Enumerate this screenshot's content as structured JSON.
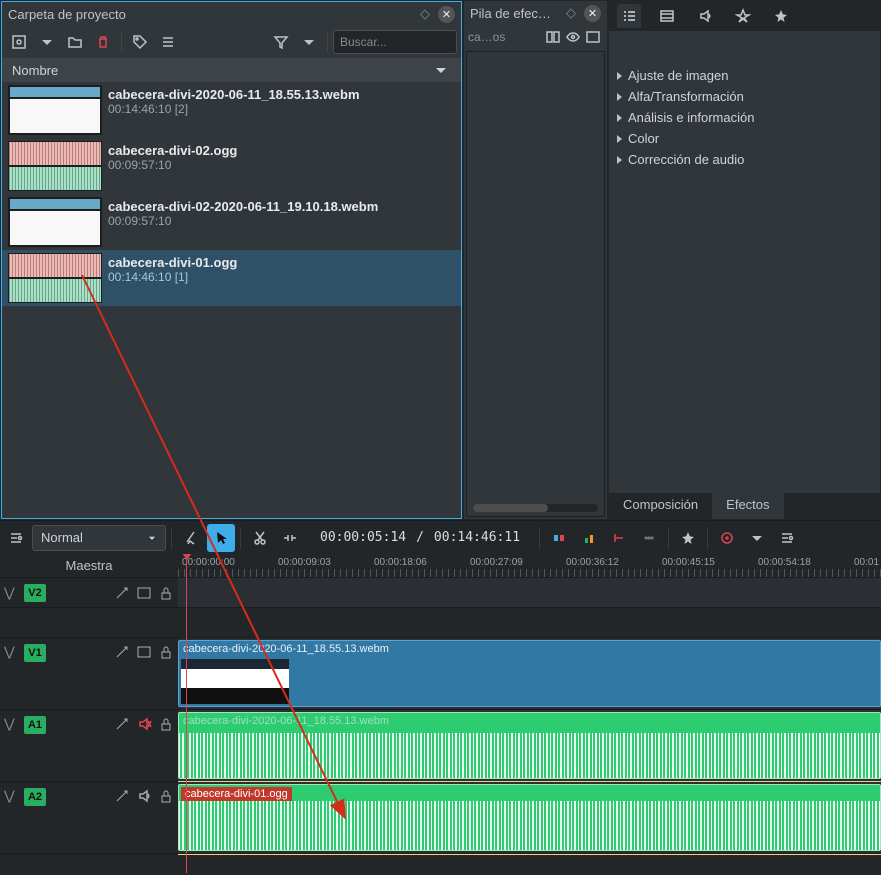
{
  "projectBin": {
    "title": "Carpeta de proyecto",
    "searchPlaceholder": "Buscar...",
    "columnHeader": "Nombre",
    "items": [
      {
        "name": "cabecera-divi-2020-06-11_18.55.13.webm",
        "duration": "00:14:46:10 [2]",
        "type": "video",
        "selected": false
      },
      {
        "name": "cabecera-divi-02.ogg",
        "duration": "00:09:57:10",
        "type": "audio",
        "selected": false
      },
      {
        "name": "cabecera-divi-02-2020-06-11_19.10.18.webm",
        "duration": "00:09:57:10",
        "type": "video",
        "selected": false
      },
      {
        "name": "cabecera-divi-01.ogg",
        "duration": "00:14:46:10 [1]",
        "type": "audio",
        "selected": true
      }
    ]
  },
  "effectStack": {
    "title": "Pila de efec…",
    "sourceLabel": "ca…os"
  },
  "effectsPanel": {
    "categories": [
      "Ajuste de imagen",
      "Alfa/Transformación",
      "Análisis e información",
      "Color",
      "Corrección de audio"
    ],
    "tabs": {
      "composition": "Composición",
      "effects": "Efectos"
    }
  },
  "timelineToolbar": {
    "editMode": "Normal",
    "currentTime": "00:00:05:14",
    "totalTime": "00:14:46:11"
  },
  "timeline": {
    "masterLabel": "Maestra",
    "rulerTicks": [
      "00:00:00:00",
      "00:00:09:03",
      "00:00:18:06",
      "00:00:27:09",
      "00:00:36:12",
      "00:00:45:15",
      "00:00:54:18",
      "00:01"
    ],
    "tracks": [
      {
        "id": "V2",
        "type": "video",
        "big": false
      },
      {
        "id": "V1",
        "type": "video",
        "big": true
      },
      {
        "id": "A1",
        "type": "audio",
        "big": true,
        "muted": true
      },
      {
        "id": "A2",
        "type": "audio",
        "big": true
      }
    ],
    "clips": {
      "v1": "cabecera-divi-2020-06-11_18.55.13.webm",
      "a1": "cabecera-divi-2020-06-11_18.55.13.webm",
      "a2": "cabecera-divi-01.ogg"
    }
  }
}
